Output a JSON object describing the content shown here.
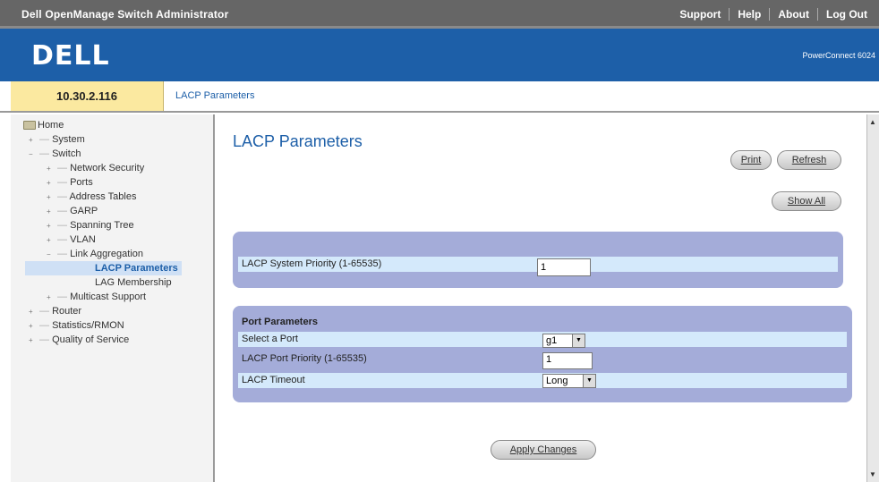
{
  "topbar": {
    "title": "Dell OpenManage Switch Administrator",
    "links": [
      "Support",
      "Help",
      "About",
      "Log Out"
    ]
  },
  "brand": {
    "logo": "DELL",
    "product": "PowerConnect 6024"
  },
  "address": {
    "ip": "10.30.2.116",
    "breadcrumb": "LACP Parameters"
  },
  "tree": {
    "root": "Home",
    "items": [
      {
        "label": "System",
        "expander": "+"
      },
      {
        "label": "Switch",
        "expander": "−"
      },
      {
        "label": "Network Security",
        "expander": "+"
      },
      {
        "label": "Ports",
        "expander": "+"
      },
      {
        "label": "Address Tables",
        "expander": "+"
      },
      {
        "label": "GARP",
        "expander": "+"
      },
      {
        "label": "Spanning Tree",
        "expander": "+"
      },
      {
        "label": "VLAN",
        "expander": "+"
      },
      {
        "label": "Link Aggregation",
        "expander": "−"
      },
      {
        "label": "LACP Parameters",
        "expander": ""
      },
      {
        "label": "LAG Membership",
        "expander": ""
      },
      {
        "label": "Multicast Support",
        "expander": "+"
      },
      {
        "label": "Router",
        "expander": "+"
      },
      {
        "label": "Statistics/RMON",
        "expander": "+"
      },
      {
        "label": "Quality of Service",
        "expander": "+"
      }
    ]
  },
  "main": {
    "title": "LACP Parameters",
    "buttons": {
      "print": "Print",
      "refresh": "Refresh",
      "show_all": "Show All",
      "apply": "Apply Changes"
    },
    "system_priority": {
      "label": "LACP System Priority (1-65535)",
      "value": "1"
    },
    "port_params": {
      "title": "Port Parameters",
      "select_port": {
        "label": "Select a Port",
        "value": "g1"
      },
      "port_priority": {
        "label": "LACP Port Priority (1-65535)",
        "value": "1"
      },
      "timeout": {
        "label": "LACP Timeout",
        "value": "Long"
      }
    }
  }
}
